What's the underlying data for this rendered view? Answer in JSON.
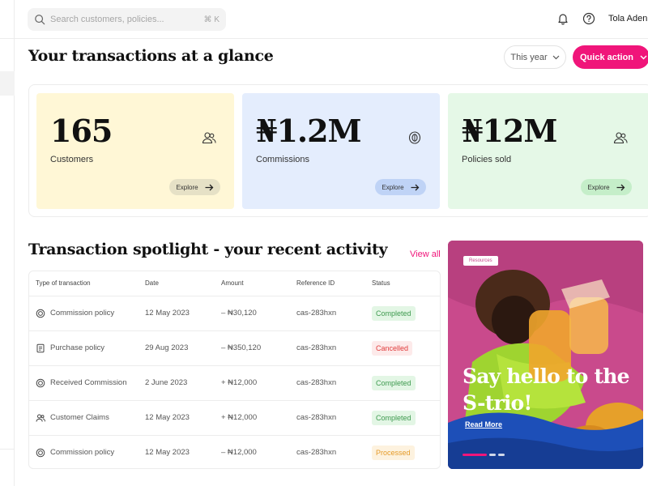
{
  "topbar": {
    "search_placeholder": "Search customers, policies...",
    "search_shortcut": "⌘ K",
    "user_name": "Tola Aden"
  },
  "header": {
    "title": "Your transactions at a glance",
    "period_select": "This year",
    "quick_action": "Quick action"
  },
  "stats": [
    {
      "value": "165",
      "label": "Customers",
      "icon": "users-icon",
      "cta": "Explore",
      "color": "#fff7d6"
    },
    {
      "value": "₦1.2M",
      "label": "Commissions",
      "icon": "coins-icon",
      "cta": "Explore",
      "color": "#e4edfd"
    },
    {
      "value": "₦12M",
      "label": "Policies sold",
      "icon": "users-icon",
      "cta": "Explore",
      "color": "#e5f8e7"
    }
  ],
  "spotlight": {
    "title": "Transaction spotlight - your recent activity",
    "view_all": "View all",
    "columns": [
      "Type of transaction",
      "Date",
      "Amount",
      "Reference ID",
      "Status"
    ],
    "rows": [
      {
        "type": "Commission policy",
        "icon": "coin-icon",
        "date": "12 May 2023",
        "amount": "– ₦30,120",
        "ref": "cas-283hxn",
        "status": "Completed"
      },
      {
        "type": "Purchase policy",
        "icon": "document-icon",
        "date": "29 Aug 2023",
        "amount": "– ₦350,120",
        "ref": "cas-283hxn",
        "status": "Cancelled"
      },
      {
        "type": "Received Commission",
        "icon": "coin-icon",
        "date": "2 June 2023",
        "amount": "+ ₦12,000",
        "ref": "cas-283hxn",
        "status": "Completed"
      },
      {
        "type": "Customer Claims",
        "icon": "users-icon",
        "date": "12 May 2023",
        "amount": "+ ₦12,000",
        "ref": "cas-283hxn",
        "status": "Completed"
      },
      {
        "type": "Commission policy",
        "icon": "coin-icon",
        "date": "12 May 2023",
        "amount": "– ₦12,000",
        "ref": "cas-283hxn",
        "status": "Processed"
      }
    ]
  },
  "promo": {
    "tag": "Resources",
    "headline": "Say hello to the S-trio!",
    "cta": "Read More"
  },
  "colors": {
    "accent": "#f0157a",
    "completed": "#3e9a4f",
    "cancelled": "#e03b3b",
    "processed": "#e59b2a"
  }
}
